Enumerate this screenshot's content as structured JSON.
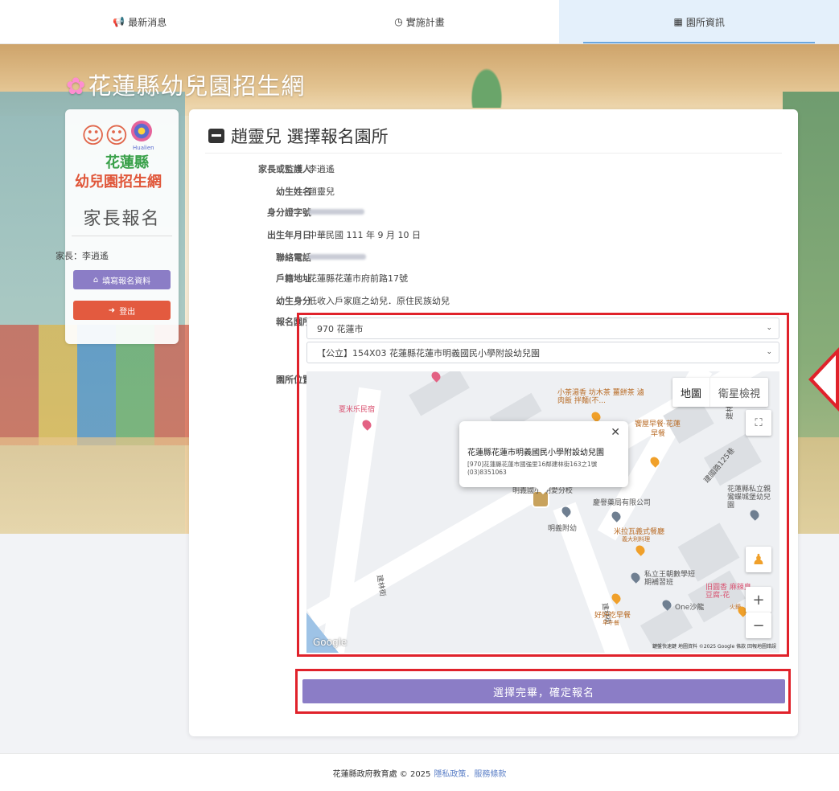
{
  "nav": {
    "tabs": [
      {
        "label": "最新消息",
        "icon": "megaphone-icon"
      },
      {
        "label": "實施計畫",
        "icon": "clock-icon"
      },
      {
        "label": "園所資訊",
        "icon": "map-icon"
      }
    ],
    "active_index": 2
  },
  "site": {
    "title": "花蓮縣幼兒園招生網"
  },
  "sidebar": {
    "logo": {
      "hualien": "Hualien",
      "county": "花蓮縣",
      "portal": "幼兒園招生網"
    },
    "role": "家長報名",
    "parent_label": "家長：李逍遙",
    "buttons": {
      "fill_form": "填寫報名資料",
      "logout": "登出"
    }
  },
  "main": {
    "heading": "趙靈兒 選擇報名園所",
    "fields": {
      "guardian": {
        "label": "家長或監護人",
        "value": "李逍遙"
      },
      "child_name": {
        "label": "幼生姓名",
        "value": "趙靈兒"
      },
      "id_number": {
        "label": "身分證字號"
      },
      "birthday": {
        "label": "出生年月日",
        "value": "中華民國 111 年 9 月 10 日"
      },
      "phone": {
        "label": "聯絡電話"
      },
      "address": {
        "label": "戶籍地址",
        "value": "花蓮縣花蓮市府前路17號"
      },
      "identity": {
        "label": "幼生身分",
        "value": "低收入戶家庭之幼兒．原住民族幼兒"
      },
      "school_select": {
        "label": "報名園所"
      },
      "school_location": {
        "label": "園所位置"
      }
    },
    "selects": {
      "district": "970 花蓮市",
      "school": "【公立】154X03 花蓮縣花蓮市明義國民小學附設幼兒園"
    },
    "map": {
      "type_map": "地圖",
      "type_satellite": "衛星檢視",
      "popup": {
        "name": "花蓮縣花蓮市明義國民小學附設幼兒園",
        "address": "[970]花蓮縣花蓮市國強里16鄰建林街163之1號",
        "phone": "(03)8351063"
      },
      "labels": {
        "homestay": "夏米乐民宿",
        "school_branch": "明義國小 明愛分校",
        "kindergarten": "明義附幼",
        "road": "建林街",
        "road2": "建國路125巷",
        "pharmacy": "慶譽藥局有限公司",
        "restaurant": "米拉瓦義式餐廳",
        "restaurant_sub": "義大利料理",
        "private_kg": "花蓮縣私立親鸞蝶城堡幼兒園",
        "cram": "私立王朝數學短期補習班",
        "one": "One沙龍",
        "breakfast": "好好吃早餐",
        "breakfast_sub": "早午餐",
        "tea": "小茶湯香 坊木茶 薑餅茶 滷肉飯 拌麵(不...",
        "morning": "饗屋早餐‧花蓮",
        "morning_sub": "早餐",
        "spicy": "旧圓香 麻辣臭豆腐-花",
        "spicy_sub": "火鍋"
      },
      "google": "Google",
      "attribution": "鍵盤快速鍵  地圖資料 ©2025 Google  條款  回報地圖錯誤"
    },
    "submit_label": "選擇完畢，確定報名"
  },
  "footer": {
    "text": "花蓮縣政府教育處 © 2025",
    "links": "隱私政策．服務條款"
  },
  "colors": {
    "accent": "#8b7dc6",
    "danger": "#e0222b",
    "logout": "#e35a3f",
    "active_tab": "#e4f0fb"
  }
}
